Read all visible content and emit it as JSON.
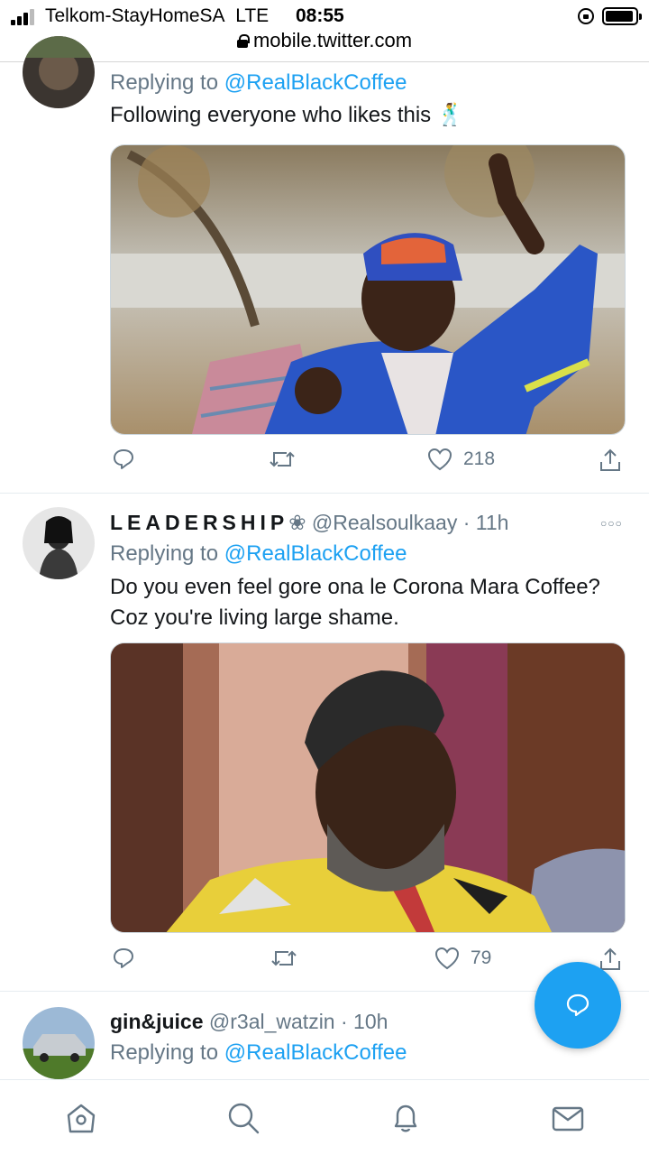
{
  "status_bar": {
    "carrier": "Telkom-StayHomeSA",
    "network": "LTE",
    "time": "08:55"
  },
  "browser": {
    "url": "mobile.twitter.com"
  },
  "tweets": [
    {
      "reply_prefix": "Replying to ",
      "reply_mention": "@RealBlackCoffee",
      "text": "Following everyone who likes this 🕺",
      "stats": {
        "replies": "",
        "retweets": "",
        "likes": "218"
      }
    },
    {
      "display_name": "LEADERSHIP",
      "name_emoji": "❀",
      "handle": "@Realsoulkaay",
      "time": "· 11h",
      "reply_prefix": "Replying to ",
      "reply_mention": "@RealBlackCoffee",
      "text_line1": "Do you even feel gore ona le Corona Mara Coffee?",
      "text_line2": "Coz you're living large shame.",
      "stats": {
        "replies": "",
        "retweets": "",
        "likes": "79"
      }
    },
    {
      "display_name": "gin&juice",
      "handle": "@r3al_watzin",
      "time": "· 10h",
      "reply_prefix": "Replying to ",
      "reply_mention": "@RealBlackCoffee"
    }
  ],
  "icons": {
    "signal": "signal-bars-icon",
    "rotation_lock": "rotation-lock-icon",
    "battery": "battery-icon",
    "padlock": "padlock-icon",
    "reply": "reply-icon",
    "retweet": "retweet-icon",
    "like": "heart-icon",
    "share": "share-icon",
    "more": "more-icon",
    "compose": "compose-icon",
    "nav_home": "home-icon",
    "nav_search": "search-icon",
    "nav_notifications": "bell-icon",
    "nav_messages": "mail-icon"
  },
  "colors": {
    "accent": "#1da1f2",
    "secondary_text": "#657786",
    "primary_text": "#14171a",
    "divider": "#e6ecf0"
  }
}
